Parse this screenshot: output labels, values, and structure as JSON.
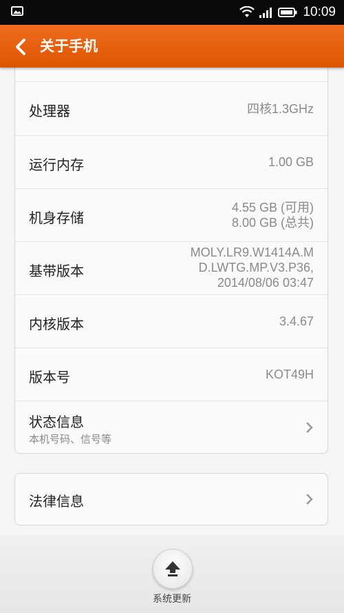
{
  "status_bar": {
    "time": "10:09",
    "icons": [
      "picture-icon",
      "wifi-icon",
      "signal-icon",
      "battery-icon"
    ]
  },
  "header": {
    "title": "关于手机",
    "back_icon": "back-chevron-icon"
  },
  "rows": [
    {
      "label": "处理器",
      "value_lines": [
        "四核1.3GHz"
      ]
    },
    {
      "label": "运行内存",
      "value_lines": [
        "1.00 GB"
      ]
    },
    {
      "label": "机身存储",
      "value_lines": [
        "4.55 GB (可用)",
        "8.00 GB (总共)"
      ]
    },
    {
      "label": "基带版本",
      "value_lines": [
        "MOLY.LR9.W1414A.M",
        "D.LWTG.MP.V3.P36,",
        "2014/08/06 03:47"
      ]
    },
    {
      "label": "内核版本",
      "value_lines": [
        "3.4.67"
      ]
    },
    {
      "label": "版本号",
      "value_lines": [
        "KOT49H"
      ]
    }
  ],
  "status_info": {
    "label": "状态信息",
    "sublabel": "本机号码、信号等"
  },
  "legal": {
    "label": "法律信息"
  },
  "bottom": {
    "update_label": "系统更新"
  },
  "colors": {
    "header": "#e85f10",
    "status_bar": "#0a0a0a"
  }
}
